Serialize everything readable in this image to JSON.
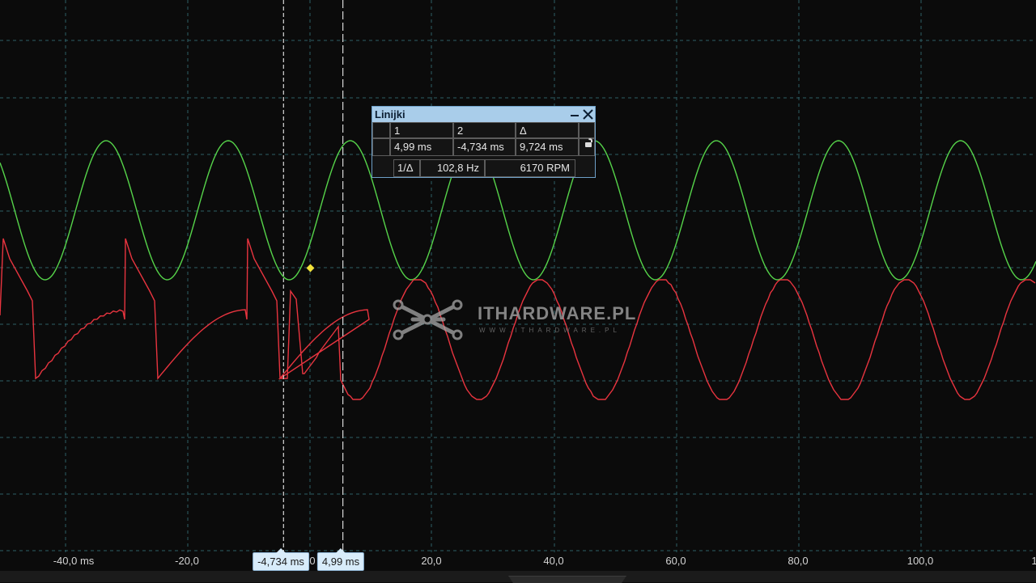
{
  "x_axis": {
    "tick_labels": [
      "-40,0 ms",
      "-20,0",
      "0",
      "20,0",
      "40,0",
      "60,0",
      "80,0",
      "100,0",
      "1"
    ],
    "tick_values": [
      -40,
      -20,
      0,
      20,
      40,
      60,
      80,
      100,
      120
    ]
  },
  "cursors": [
    {
      "label": "-4,734 ms",
      "value_ms": -4.734
    },
    {
      "label": "4,99 ms",
      "value_ms": 4.99
    }
  ],
  "rulers_panel": {
    "title": "Linijki",
    "headers": [
      "1",
      "2",
      "Δ"
    ],
    "values": [
      "4,99 ms",
      "-4,734 ms",
      "9,724 ms"
    ],
    "inverse_label": "1/Δ",
    "frequency": "102,8 Hz",
    "rpm": "6170 RPM",
    "lock_icon": "unlock-icon",
    "close_icon": "close-icon",
    "minimize_icon": "minimize-icon"
  },
  "watermark": {
    "text": "ITHARDWARE.PL",
    "subtext": "WWW.ITHARDWARE.PL"
  },
  "colors": {
    "background": "#0b0b0b",
    "grid": "#2d5f66",
    "green_trace": "#56d44a",
    "red_trace": "#e8343f",
    "cursor_line": "#d8d8d8",
    "marker": "#f2e23a"
  },
  "traces": {
    "green": {
      "type": "sine",
      "period_ms": 20,
      "amplitude_div": 1.1,
      "center_div": 0.0
    },
    "red": {
      "type": "distorted-then-sine",
      "period_ms": 20
    }
  }
}
